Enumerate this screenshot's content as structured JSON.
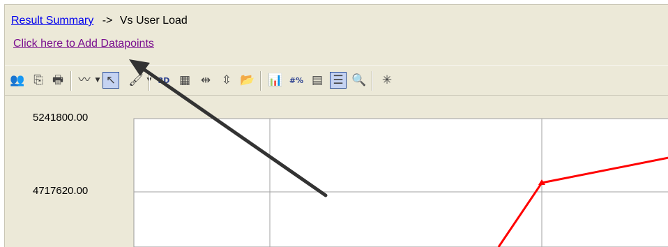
{
  "breadcrumb": {
    "link": "Result Summary",
    "separator": "->",
    "current": "Vs User Load"
  },
  "add_datapoints_link": "Click here to Add Datapoints",
  "toolbar": {
    "buttons": [
      {
        "name": "users-icon",
        "glyph": "👥",
        "pressed": false
      },
      {
        "name": "copy-icon",
        "glyph": "⎘",
        "pressed": false
      },
      {
        "name": "print-icon",
        "glyph": "🖶",
        "pressed": false
      },
      {
        "name": "chart-type-icon",
        "glyph": "〰",
        "pressed": false,
        "dropdown": true
      },
      {
        "name": "select-arrow-icon",
        "glyph": "↖",
        "pressed": true
      },
      {
        "name": "brush-icon",
        "glyph": "🖌",
        "pressed": false,
        "dropdown": true
      },
      {
        "name": "3d-zoom-icon",
        "glyph": "3D",
        "pressed": false
      },
      {
        "name": "grid-icon",
        "glyph": "▦",
        "pressed": false
      },
      {
        "name": "horizontal-flip-icon",
        "glyph": "⇹",
        "pressed": false
      },
      {
        "name": "vertical-flip-icon",
        "glyph": "⇳",
        "pressed": false
      },
      {
        "name": "export-icon",
        "glyph": "📂",
        "pressed": false
      },
      {
        "name": "chart-wizard-icon",
        "glyph": "📊",
        "pressed": false
      },
      {
        "name": "number-format-icon",
        "glyph": "#%",
        "pressed": false
      },
      {
        "name": "data-table-icon",
        "glyph": "▤",
        "pressed": false
      },
      {
        "name": "legend-icon",
        "glyph": "☰",
        "pressed": true
      },
      {
        "name": "zoom-icon",
        "glyph": "🔍",
        "pressed": false
      },
      {
        "name": "magic-wand-icon",
        "glyph": "✳",
        "pressed": false
      }
    ]
  },
  "chart_data": {
    "type": "line",
    "y_tick_labels": [
      "5241800.00",
      "4717620.00"
    ],
    "y_ticks": [
      5241800.0,
      4717620.0
    ],
    "series": [
      {
        "color": "#ff0000",
        "points": [
          [
            2.85,
            4390000
          ],
          [
            3.0,
            4700000
          ],
          [
            4.0,
            4800000
          ]
        ]
      }
    ],
    "xlim": [
      0,
      4
    ],
    "ylim": [
      4400000,
      5241800
    ],
    "grid": true
  },
  "annotation": {
    "color": "#333333"
  }
}
